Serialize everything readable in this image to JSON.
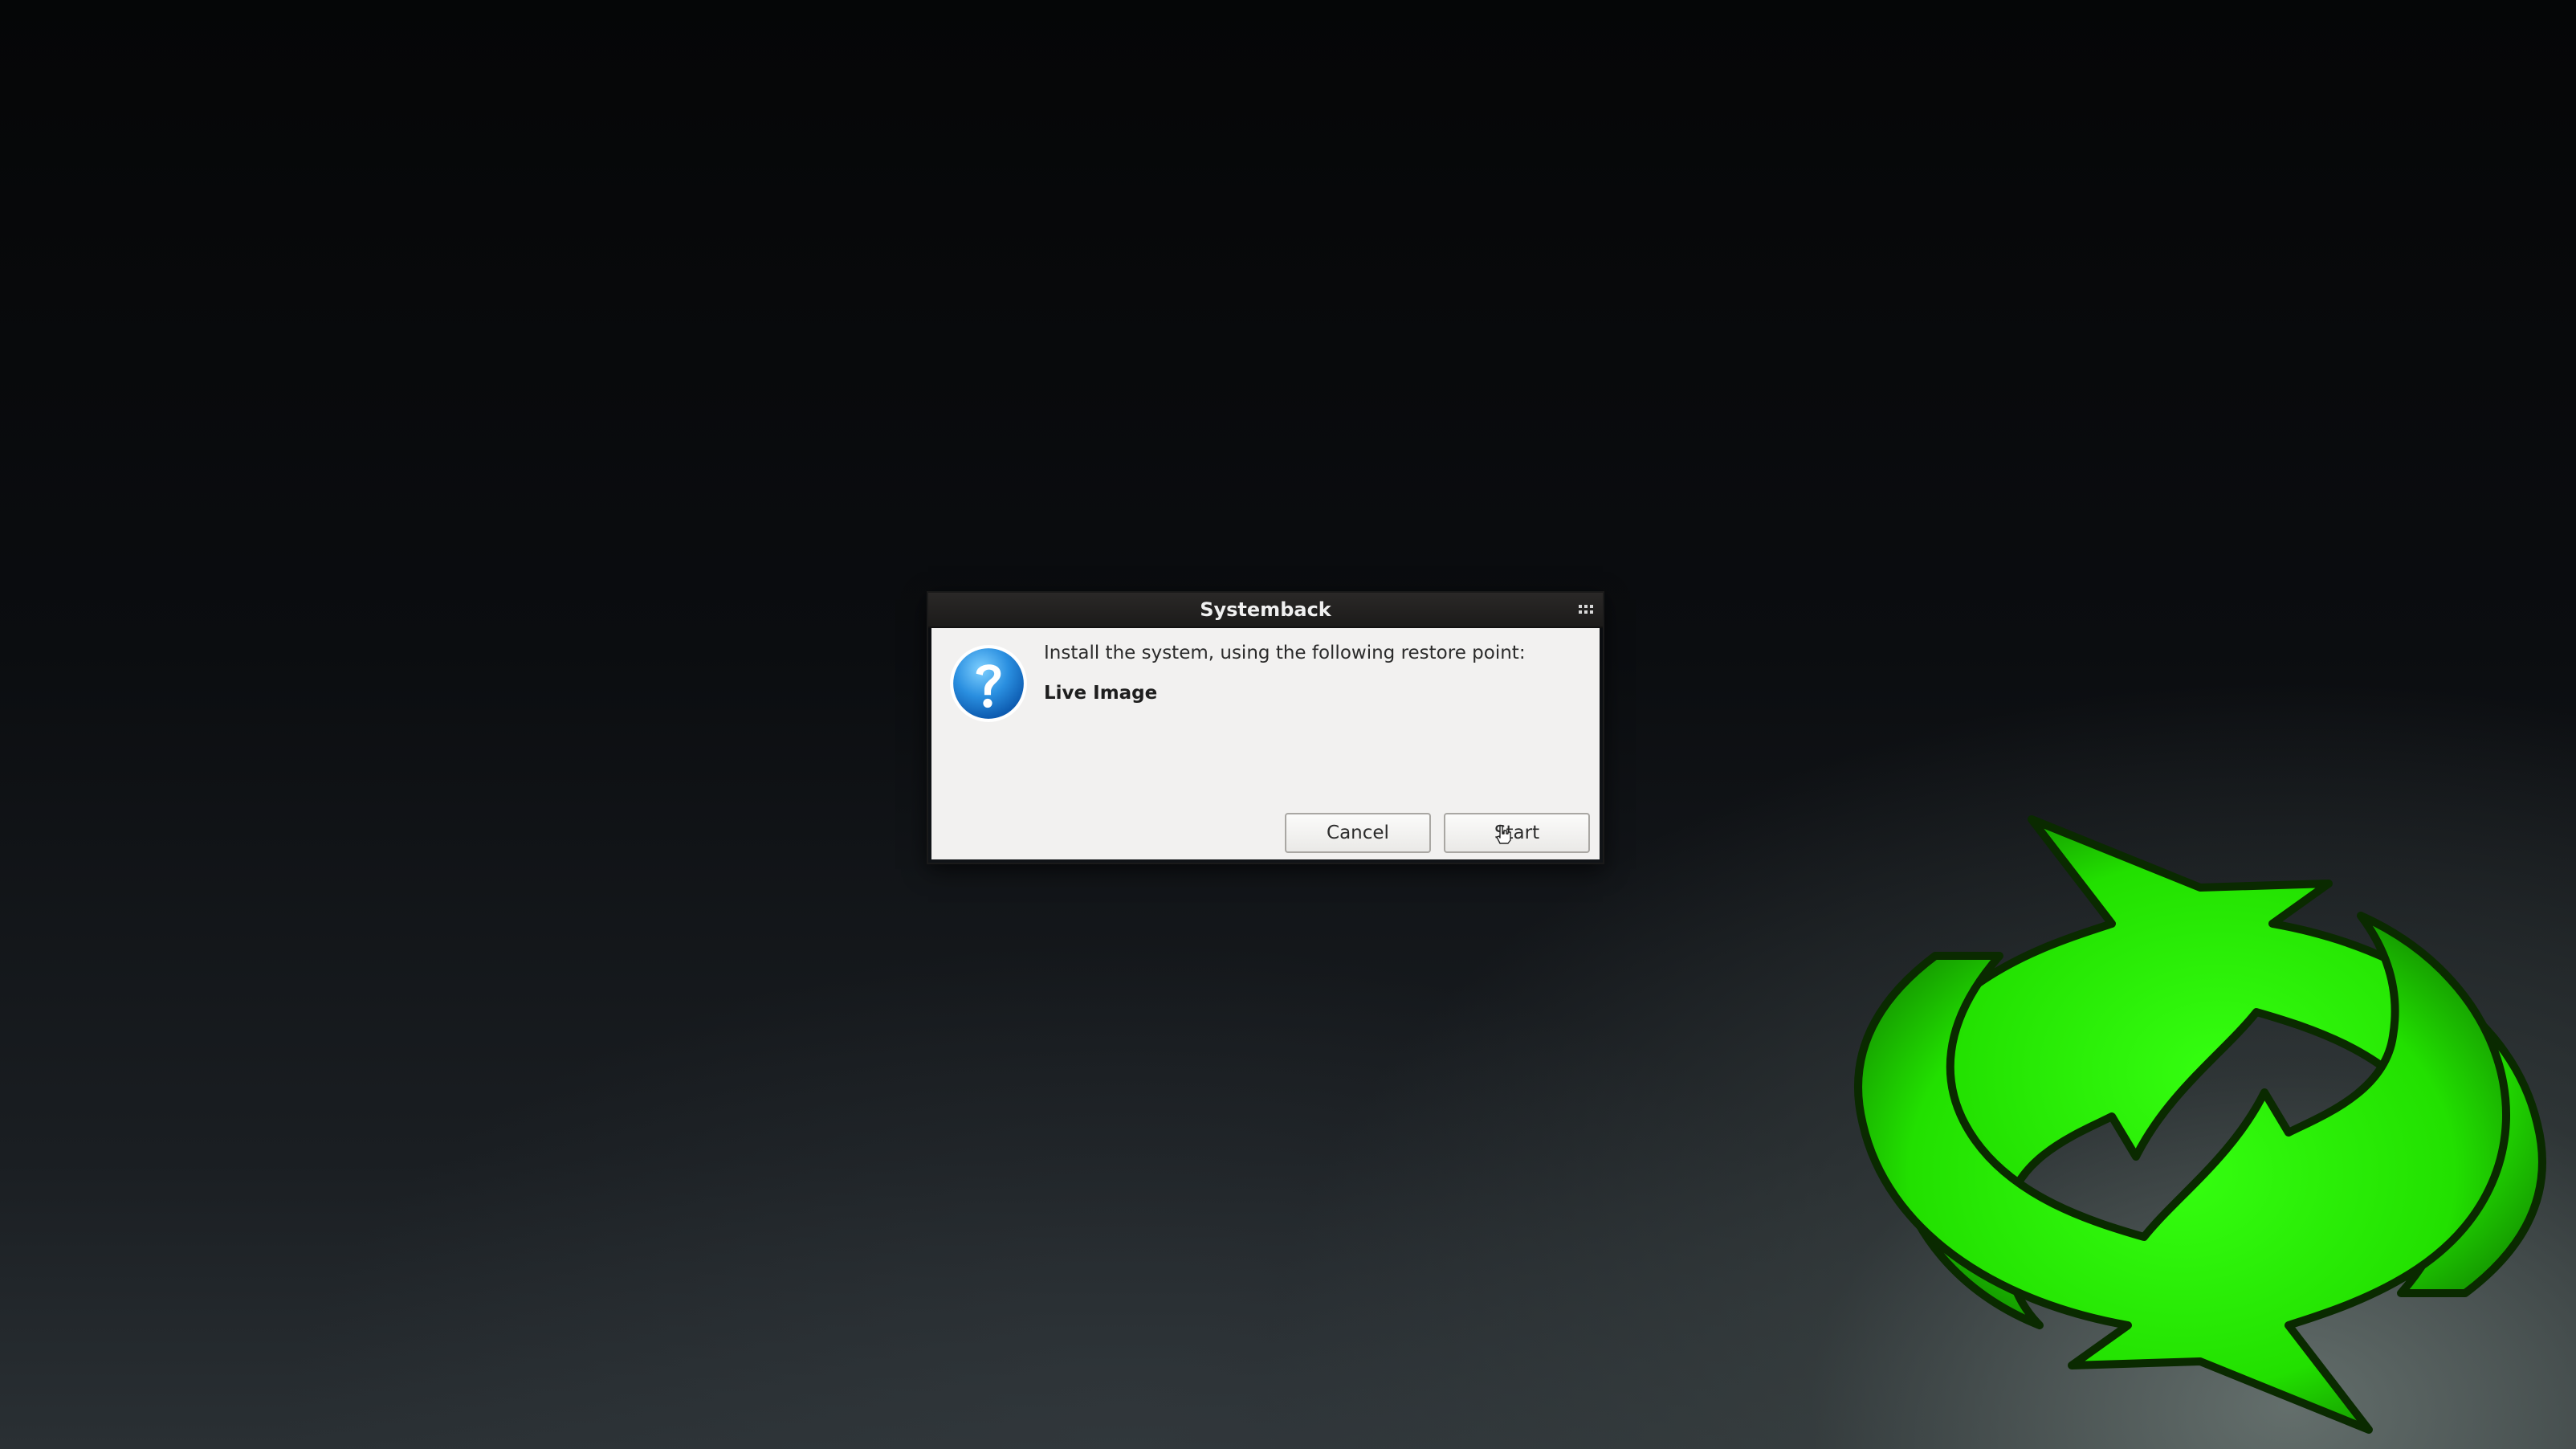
{
  "dialog": {
    "title": "Systemback",
    "message": "Install the system, using the following restore point:",
    "restore_point": "Live Image",
    "buttons": {
      "cancel": "Cancel",
      "start": "Start"
    },
    "icon": "question-icon",
    "window_menu_icon": "window-menu-grip-icon"
  },
  "background": {
    "logo_icon": "systemback-refresh-arrows-icon",
    "logo_color": "#22e000"
  }
}
